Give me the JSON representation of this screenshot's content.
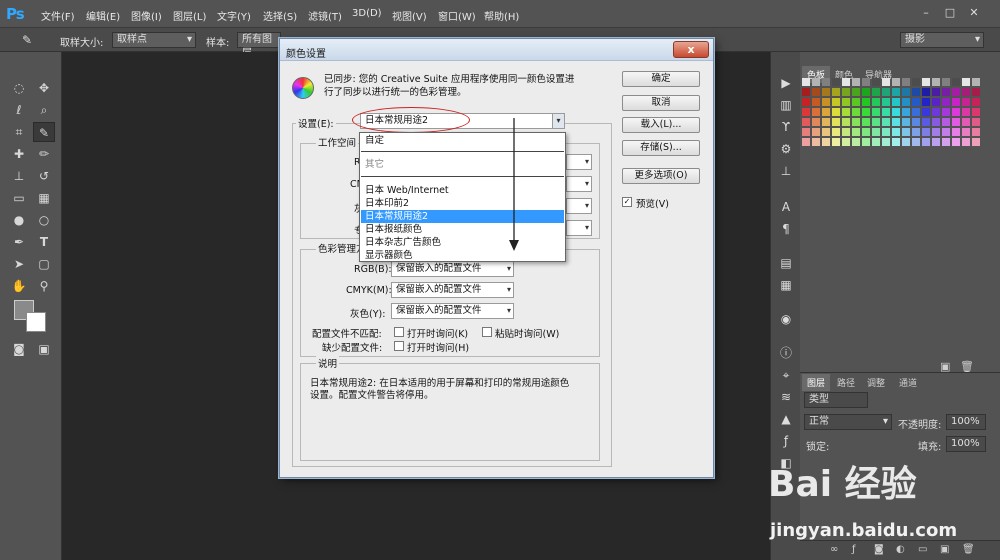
{
  "app": {
    "logo": "Ps"
  },
  "menubar": {
    "items": [
      "文件(F)",
      "编辑(E)",
      "图像(I)",
      "图层(L)",
      "文字(Y)",
      "选择(S)",
      "滤镜(T)",
      "3D(D)",
      "视图(V)",
      "窗口(W)",
      "帮助(H)"
    ]
  },
  "window_controls": {
    "minimize": "–",
    "restore": "□",
    "close": "✕"
  },
  "options": {
    "sample_size_label": "取样大小:",
    "sample_size_value": "取样点",
    "sample_label": "样本:",
    "sample_value": "所有图层",
    "workspace": "摄影"
  },
  "dialog": {
    "title": "颜色设置",
    "close": "x",
    "sync_text_line1": "已同步: 您的 Creative Suite 应用程序使用同一颜色设置进",
    "sync_text_line2": "行了同步以进行统一的色彩管理。",
    "settings_label": "设置(E):",
    "settings_value": "日本常规用途2",
    "workspace_group": "工作空间",
    "rgb_short": "RG",
    "cmyk_short": "CM",
    "gray_short": "灰",
    "spot_short": "专",
    "cm_group": "色彩管理方",
    "rgb_label": "RGB(B):",
    "rgb_value": "保留嵌入的配置文件",
    "cmyk_label": "CMYK(M):",
    "cmyk_value": "保留嵌入的配置文件",
    "gray_label": "灰色(Y):",
    "gray_value": "保留嵌入的配置文件",
    "mismatch_label": "配置文件不匹配:",
    "mismatch_open": "打开时询问(K)",
    "mismatch_paste": "粘贴时询问(W)",
    "missing_label": "缺少配置文件:",
    "missing_open": "打开时询问(H)",
    "desc_group": "说明",
    "desc_line1": "日本常规用途2:  在日本适用的用于屏幕和打印的常规用途颜色",
    "desc_line2": "设置。配置文件警告将停用。",
    "buttons": {
      "ok": "确定",
      "cancel": "取消",
      "load": "载入(L)...",
      "save": "存储(S)...",
      "more": "更多选项(O)"
    },
    "preview_label": "预览(V)",
    "preview_checked": "✓"
  },
  "dropdown": {
    "items": [
      "自定",
      "其它",
      "日本 Web/Internet",
      "日本印前2",
      "日本常规用途2",
      "日本报纸颜色",
      "日本杂志广告颜色",
      "显示器颜色"
    ],
    "selected_index": 4
  },
  "panels": {
    "color_tabs": [
      "色板",
      "颜色",
      "导航器"
    ],
    "layer_tabs": [
      "图层",
      "路径",
      "调整",
      "通道"
    ],
    "kind": "类型",
    "blend": "正常",
    "opacity_label": "不透明度:",
    "opacity_value": "100%",
    "lock_label": "锁定:",
    "fill_label": "填充:",
    "fill_value": "100%"
  },
  "watermark": {
    "line1": "Bai 经验",
    "line2": "jingyan.baidu.com"
  },
  "colors": {
    "accent": "#31a8ff",
    "selection": "#3399ff",
    "annotation": "#cc2222"
  }
}
